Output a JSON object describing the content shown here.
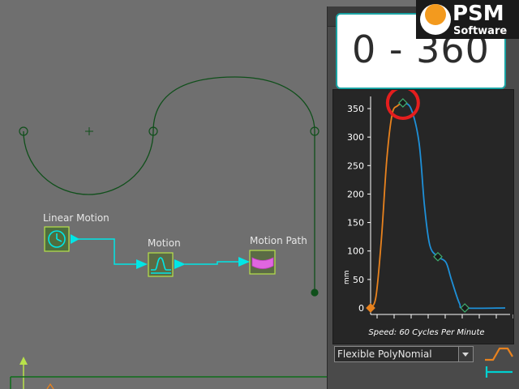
{
  "canvas": {
    "nodes": {
      "linear_motion_label": "Linear Motion",
      "motion_label": "Motion",
      "motion_path_label": "Motion Path"
    }
  },
  "callout": {
    "text": "0 - 360"
  },
  "logo": {
    "line1": "PSM",
    "line2": "Software"
  },
  "graph_panel": {
    "caption": "Speed: 60 Cycles Per Minute",
    "dropdown_value": "Flexible PolyNomial"
  },
  "chart_data": {
    "type": "line",
    "ylabel": "mm",
    "ylim": [
      0,
      380
    ],
    "yticks": [
      0,
      50,
      100,
      150,
      200,
      250,
      300,
      350
    ],
    "ytick_labels": [
      "0",
      "50",
      "100",
      "150",
      "200",
      "250",
      "300",
      "350"
    ],
    "x_range": [
      0,
      100
    ],
    "series": [
      {
        "color": "#e8821e",
        "points": [
          [
            0,
            0
          ],
          [
            4,
            20
          ],
          [
            8,
            120
          ],
          [
            12,
            260
          ],
          [
            16,
            340
          ],
          [
            20,
            355
          ],
          [
            24,
            360
          ]
        ]
      },
      {
        "color": "#1e90d8",
        "points": [
          [
            24,
            360
          ],
          [
            30,
            350
          ],
          [
            36,
            290
          ],
          [
            40,
            180
          ],
          [
            44,
            110
          ],
          [
            50,
            90
          ],
          [
            56,
            80
          ],
          [
            60,
            50
          ],
          [
            66,
            8
          ],
          [
            70,
            0
          ],
          [
            100,
            0
          ]
        ]
      }
    ],
    "control_points": [
      {
        "x": 0,
        "y": 0,
        "color": "#e8821e"
      },
      {
        "x": 24,
        "y": 360,
        "color": "#1a1a1a"
      },
      {
        "x": 50,
        "y": 90,
        "color": "#1a1a1a"
      },
      {
        "x": 70,
        "y": 0,
        "color": "#1a1a1a"
      }
    ],
    "highlight": {
      "x": 24,
      "y": 360,
      "color": "#e41e1e"
    },
    "grid": false
  },
  "colors": {
    "path": "#0f4f1a",
    "connector": "#00e6e6",
    "node_fill": "#b8e24a",
    "orange_curve": "#e8821e",
    "blue_curve": "#1e90d8",
    "callout_border": "#1aa3a3"
  }
}
